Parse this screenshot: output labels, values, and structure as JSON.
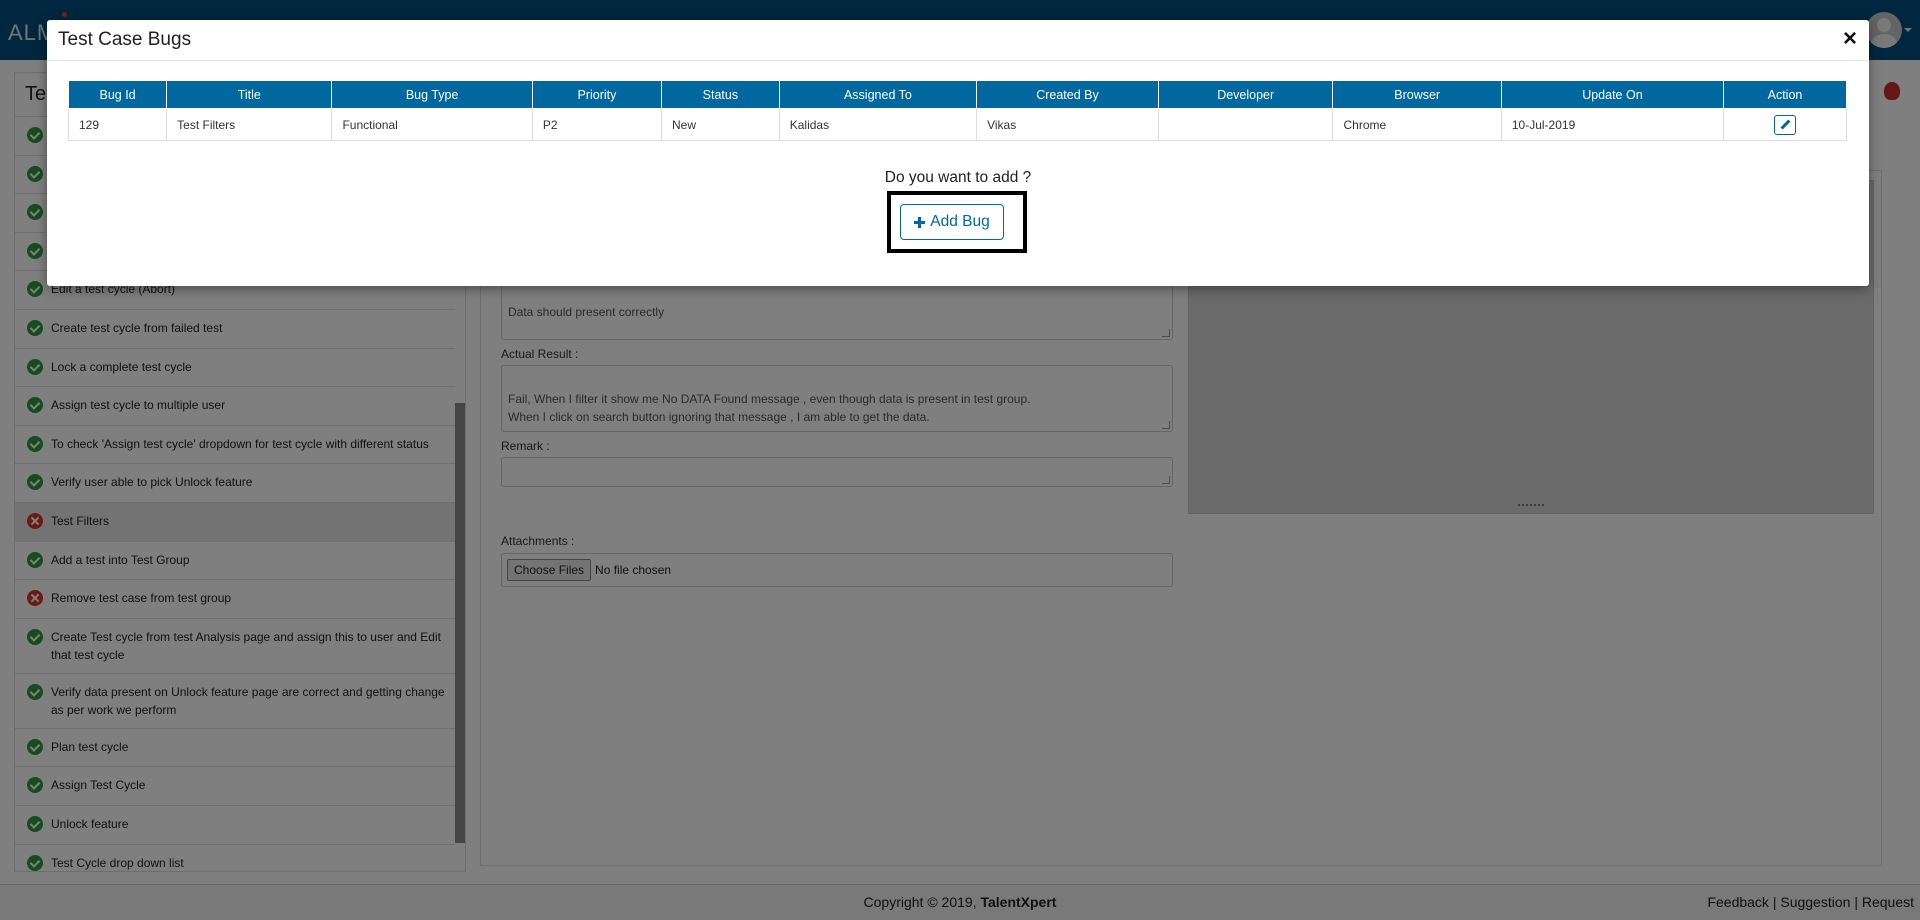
{
  "app": {
    "brand": "ALM"
  },
  "left_panel": {
    "title": "Te",
    "tests": [
      {
        "label": "",
        "status": "pass"
      },
      {
        "label": "",
        "status": "pass"
      },
      {
        "label": "",
        "status": "pass"
      },
      {
        "label": "",
        "status": "pass"
      },
      {
        "label": "Edit a test cycle (Abort)",
        "status": "pass"
      },
      {
        "label": "Create test cycle from failed test",
        "status": "pass"
      },
      {
        "label": "Lock a complete test cycle",
        "status": "pass"
      },
      {
        "label": "Assign test cycle to multiple user",
        "status": "pass"
      },
      {
        "label": "To check 'Assign test cycle' dropdown for test cycle with different status",
        "status": "pass"
      },
      {
        "label": "Verify user able to pick Unlock feature",
        "status": "pass"
      },
      {
        "label": "Test Filters",
        "status": "fail"
      },
      {
        "label": "Add a test into Test Group",
        "status": "pass"
      },
      {
        "label": "Remove test case from test group",
        "status": "fail"
      },
      {
        "label": "Create Test cycle from test Analysis page and assign this to user and Edit that test cycle",
        "status": "pass"
      },
      {
        "label": "Verify data present on Unlock feature page are correct and getting change as per work we perform",
        "status": "pass"
      },
      {
        "label": "Plan test cycle",
        "status": "pass"
      },
      {
        "label": "Assign Test Cycle",
        "status": "pass"
      },
      {
        "label": "Unlock feature",
        "status": "pass"
      },
      {
        "label": "Test Cycle drop down list",
        "status": "pass"
      }
    ]
  },
  "main": {
    "expected_value": "Data should present correctly",
    "actual_label": "Actual Result :",
    "actual_value": "Fail, When I filter it show me No DATA Found message , even though data is present in test group.\nWhen I click on search button ignoring that message , I am able to get the data.",
    "remark_label": "Remark :",
    "remark_value": "",
    "attachments_label": "Attachments :",
    "choose_files_label": "Choose Files",
    "file_status": "No file chosen"
  },
  "modal": {
    "title": "Test Case Bugs",
    "close_label": "×",
    "columns": [
      "Bug Id",
      "Title",
      "Bug Type",
      "Priority",
      "Status",
      "Assigned To",
      "Created By",
      "Developer",
      "Browser",
      "Update On",
      "Action"
    ],
    "rows": [
      {
        "bug_id": "129",
        "title": "Test Filters",
        "bug_type": "Functional",
        "priority": "P2",
        "status": "New",
        "assigned_to": "Kalidas",
        "created_by": "Vikas",
        "developer": "",
        "browser": "Chrome",
        "update_on": "10-Jul-2019"
      }
    ],
    "question": "Do you want to add ?",
    "add_bug_label": "Add Bug"
  },
  "footer": {
    "copyright": "Copyright © 2019,",
    "company": "TalentXpert",
    "feedback": "Feedback",
    "suggestion": "Suggestion",
    "request": "Request",
    "separator": "|"
  },
  "colors": {
    "header_bg": "#014f7f",
    "table_header": "#00679f",
    "pass": "#2e9a3c",
    "fail": "#d9342b"
  }
}
